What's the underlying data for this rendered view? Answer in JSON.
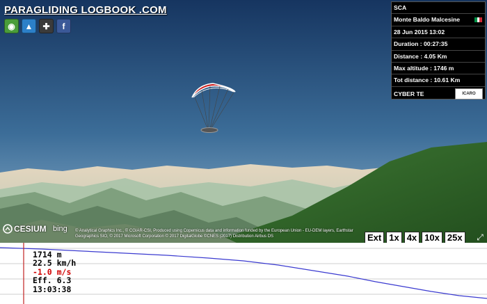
{
  "header": {
    "brand": "PARAGLIDING LOGBOOK .COM"
  },
  "share_icons": [
    "google-earth-icon",
    "google-maps-3d-icon",
    "gamepad-icon",
    "facebook-icon"
  ],
  "info_panel": {
    "pilot": "SCA",
    "site": "Monte Baldo Malcesine",
    "flag_country": "Italy",
    "datetime": "28 Jun 2015 13:02",
    "duration": "Duration : 00:27:35",
    "distance": "Distance : 4.05 Km",
    "max_altitude": "Max altitude : 1746 m",
    "tot_distance": "Tot distance : 10.61 Km",
    "wing": "CYBER TE",
    "wing_brand": "ICARO"
  },
  "credits": {
    "cesium": "CESIUM",
    "bing": "bing",
    "text": "© Analytical Graphics Inc., © CGIAR-CSI, Produced using Copernicus data and information funded by the European Union - EU-DEM layers, Earthstar Geographics SIO, © 2017 Microsoft Corporation © 2017 DigitalGlobe ©CNES (2017) Distribution Airbus DS"
  },
  "playback": {
    "extent_label": "Ext",
    "speeds": [
      "1x",
      "4x",
      "10x",
      "25x"
    ]
  },
  "readout": {
    "altitude": "1714 m",
    "speed": "22.5 km/h",
    "vario": "-1.0 m/s",
    "efficiency": "Eff. 6.3",
    "time": "13:03:38"
  },
  "colors": {
    "sky": "#1c3b64",
    "vario_negative": "#d00000",
    "profile_line": "#3a3ad0",
    "cursor": "#c02020"
  }
}
